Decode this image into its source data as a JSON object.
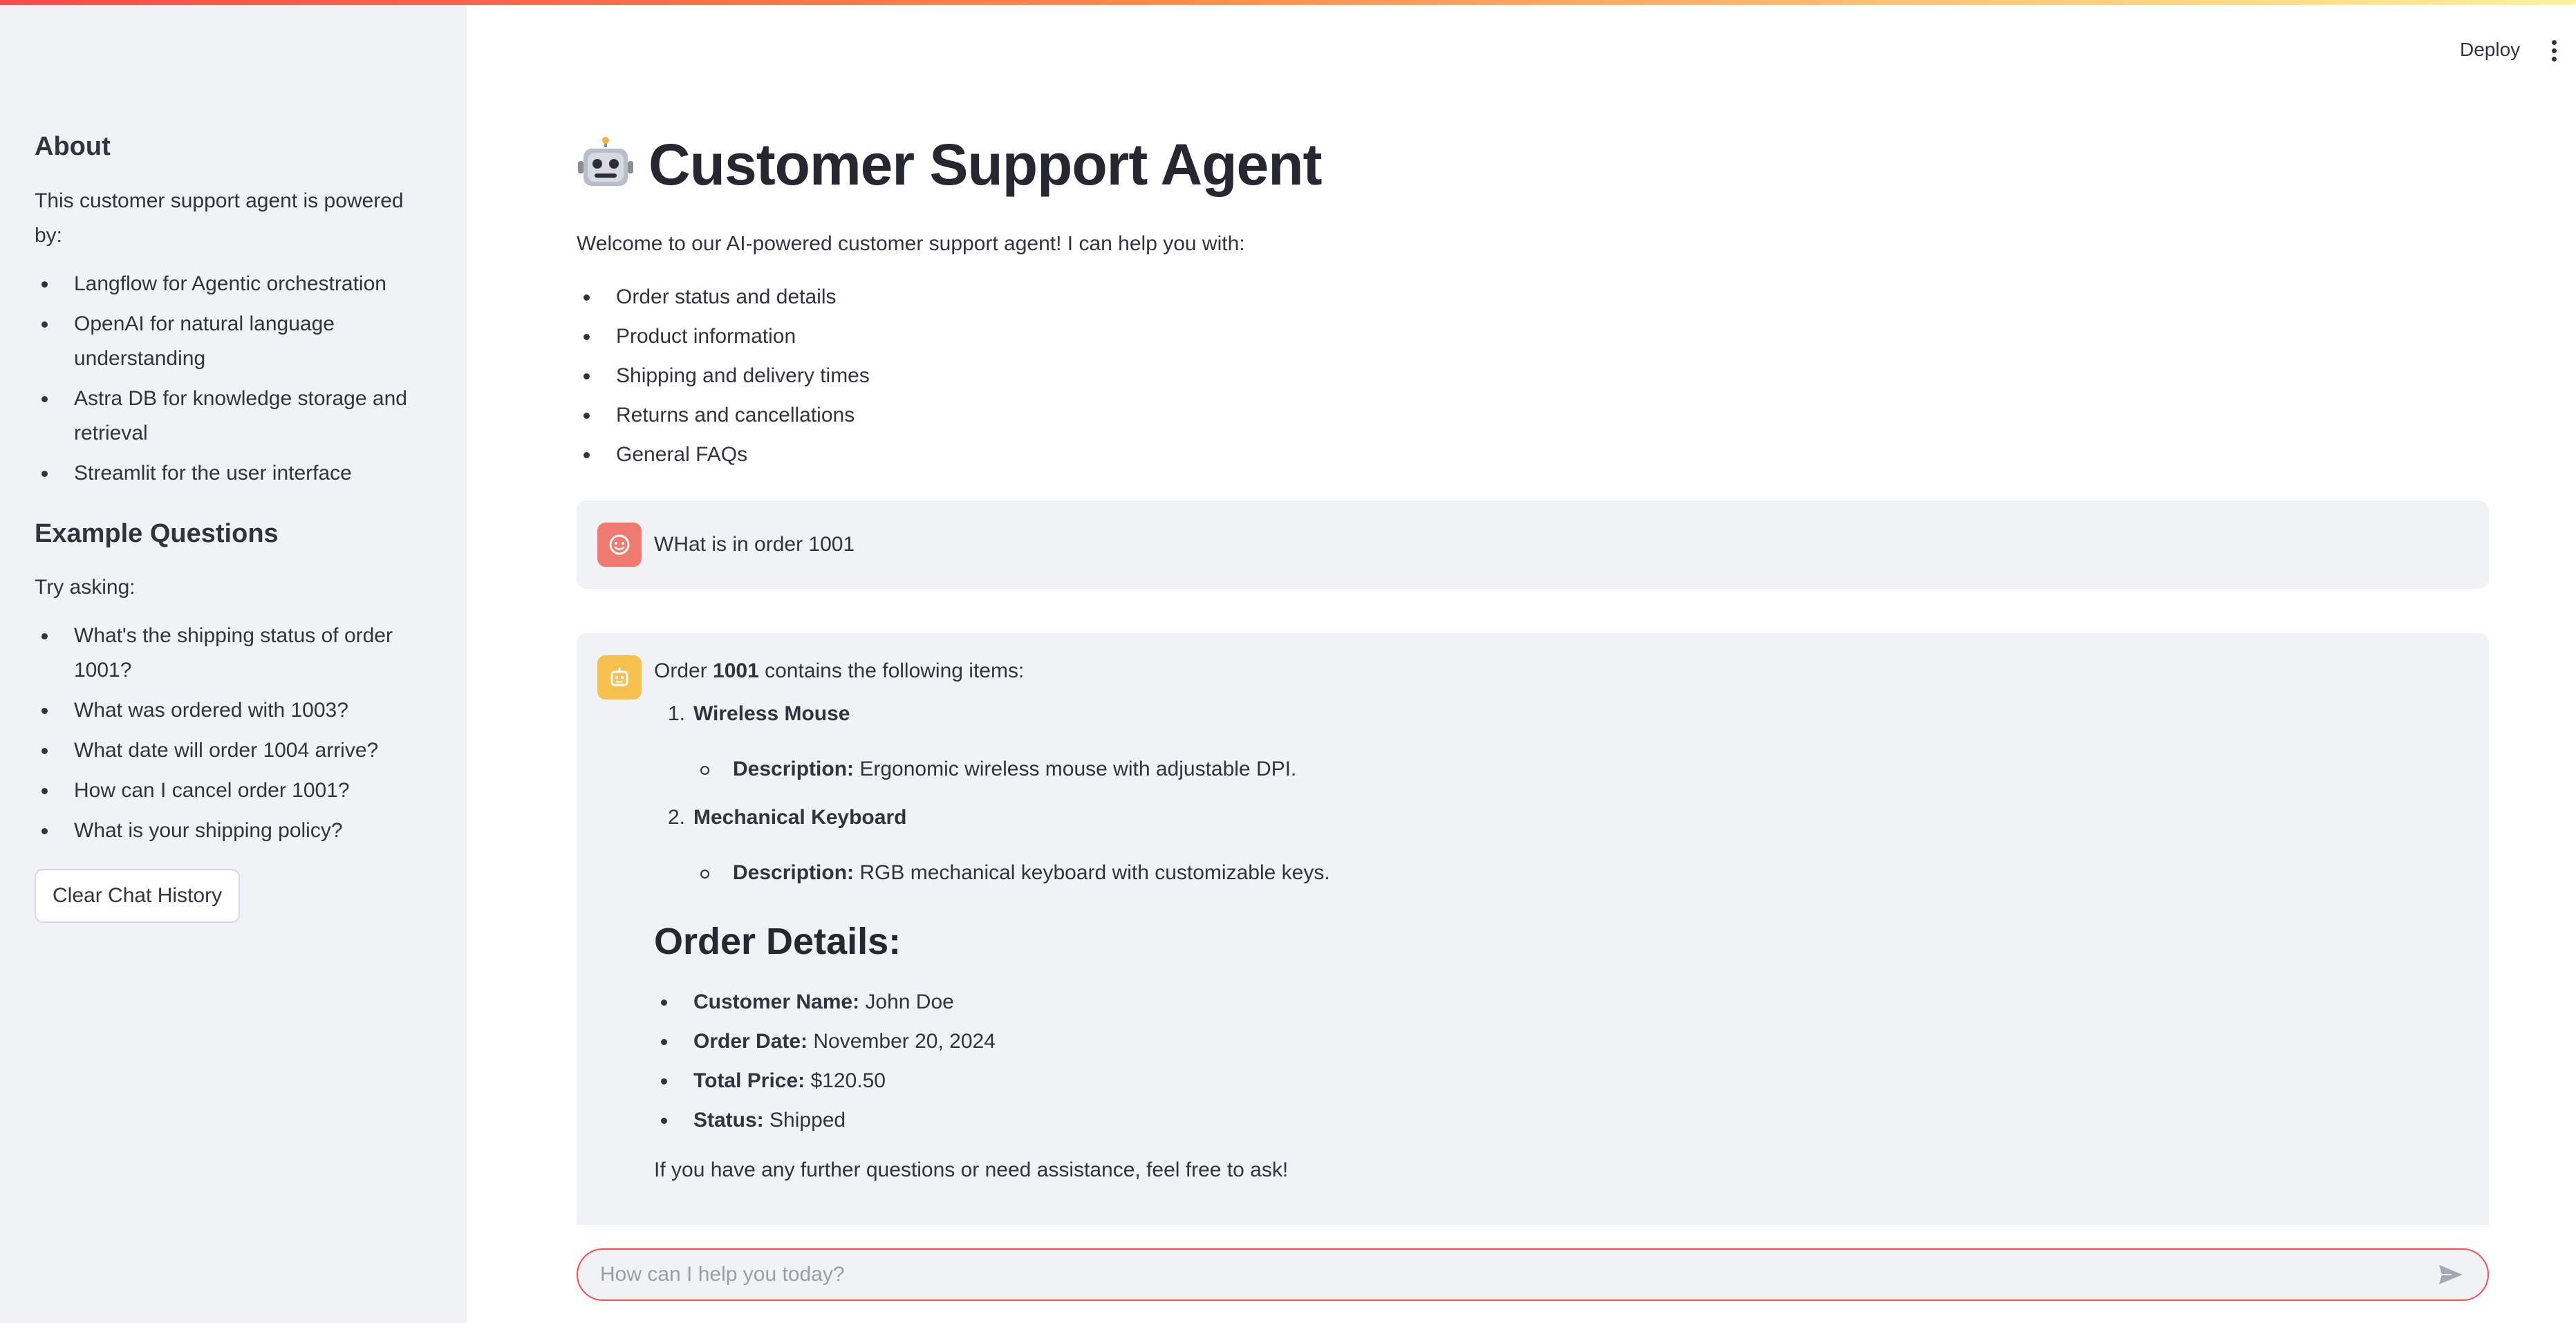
{
  "header": {
    "deploy_label": "Deploy",
    "menu_icon": "kebab-menu-icon"
  },
  "sidebar": {
    "about_heading": "About",
    "about_text": "This customer support agent is powered by:",
    "powered_by": [
      "Langflow for Agentic orchestration",
      "OpenAI for natural language understanding",
      "Astra DB for knowledge storage and retrieval",
      "Streamlit for the user interface"
    ],
    "examples_heading": "Example Questions",
    "examples_intro": "Try asking:",
    "examples": [
      "What's the shipping status of order 1001?",
      "What was ordered with 1003?",
      "What date will order 1004 arrive?",
      "How can I cancel order 1001?",
      "What is your shipping policy?"
    ],
    "clear_button": "Clear Chat History"
  },
  "main": {
    "title_emoji": "🤖",
    "title": "Customer Support Agent",
    "intro": "Welcome to our AI-powered customer support agent! I can help you with:",
    "capabilities": [
      "Order status and details",
      "Product information",
      "Shipping and delivery times",
      "Returns and cancellations",
      "General FAQs"
    ]
  },
  "chat": {
    "user_message": "WHat is in order 1001",
    "bot": {
      "intro_prefix": "Order ",
      "intro_order": "1001",
      "intro_suffix": " contains the following items:",
      "items": [
        {
          "num": "1.",
          "name": "Wireless Mouse",
          "desc_label": "Description:",
          "desc": " Ergonomic wireless mouse with adjustable DPI."
        },
        {
          "num": "2.",
          "name": "Mechanical Keyboard",
          "desc_label": "Description:",
          "desc": " RGB mechanical keyboard with customizable keys."
        }
      ],
      "details_heading": "Order Details:",
      "details": [
        {
          "label": "Customer Name:",
          "value": " John Doe"
        },
        {
          "label": "Order Date:",
          "value": " November 20, 2024"
        },
        {
          "label": "Total Price:",
          "value": " $120.50"
        },
        {
          "label": "Status:",
          "value": " Shipped"
        }
      ],
      "closing": "If you have any further questions or need assistance, feel free to ask!"
    }
  },
  "input": {
    "placeholder": "How can I help you today?"
  },
  "colors": {
    "accent": "#ff4b4b",
    "sidebar_bg": "#f0f2f6",
    "user_avatar": "#ee7a70",
    "bot_avatar": "#f6c04f"
  }
}
